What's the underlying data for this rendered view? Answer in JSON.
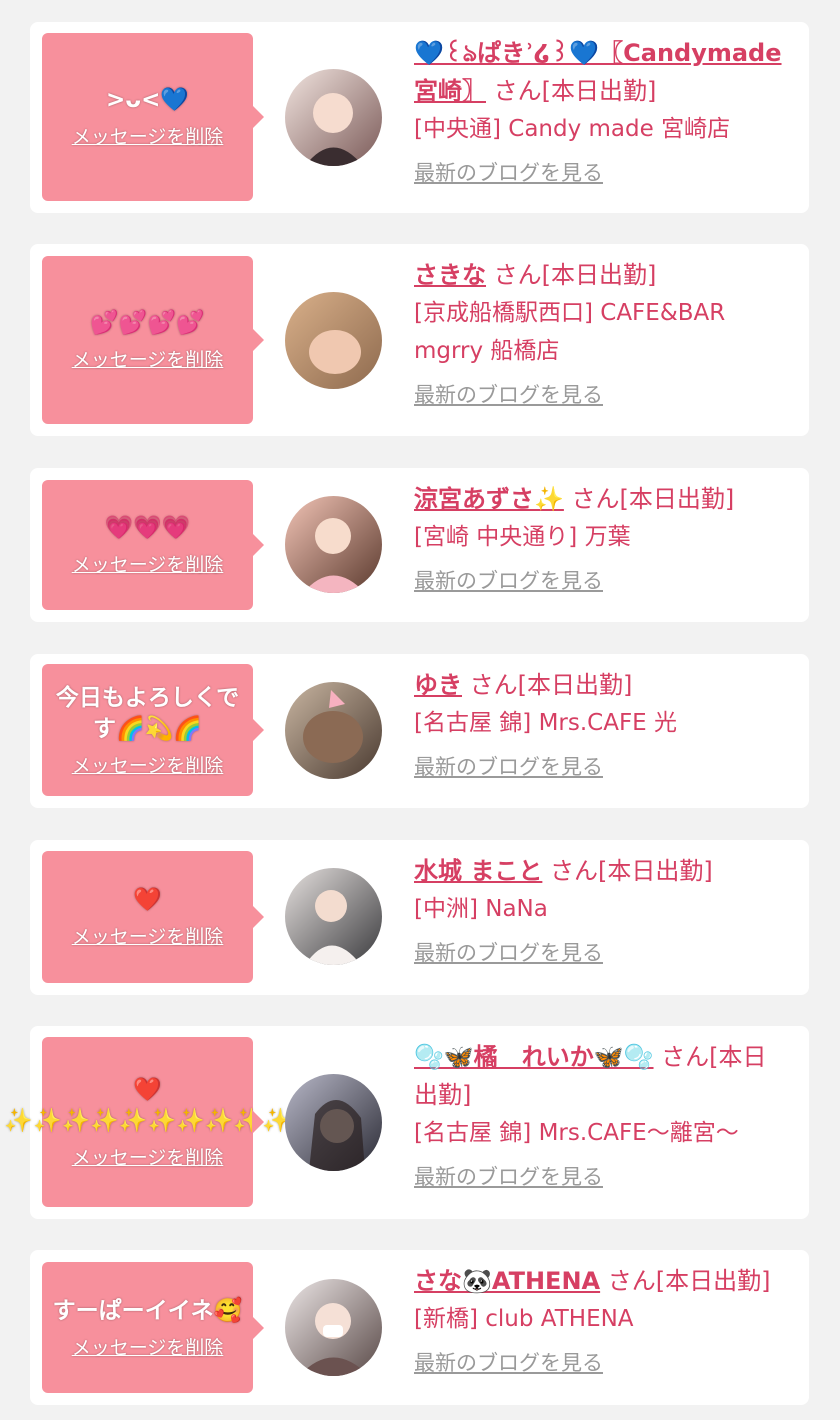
{
  "cards": [
    {
      "message": ">ᴗ<💙",
      "delete_label": "メッセージを削除",
      "name": "💙꒰ঌぱきʾ໒꒱💙〖Candymade宮崎〗",
      "suffix": " さん[本日出勤]",
      "shop": "[中央通] Candy made 宮崎店",
      "blog_label": "最新のブログを見る",
      "avatar_colors": [
        "#f1e4df",
        "#7b5a58"
      ]
    },
    {
      "message": "💕💕💕💕",
      "delete_label": "メッセージを削除",
      "name": "さきな",
      "suffix": " さん[本日出勤]",
      "shop": "[京成船橋駅西口] CAFE&BAR mgrry 船橋店",
      "blog_label": "最新のブログを見る",
      "avatar_colors": [
        "#d9b08a",
        "#8e6a4e"
      ]
    },
    {
      "message": "💗💗💗",
      "delete_label": "メッセージを削除",
      "name": "涼宮あずさ✨",
      "suffix": " さん[本日出勤]",
      "shop": "[宮崎 中央通り] 万葉",
      "blog_label": "最新のブログを見る",
      "avatar_colors": [
        "#f2c4b6",
        "#5b3a2e"
      ]
    },
    {
      "message": "今日もよろしくです🌈💫🌈",
      "delete_label": "メッセージを削除",
      "name": "ゆき",
      "suffix": " さん[本日出勤]",
      "shop": "[名古屋 錦] Mrs.CAFE 光",
      "blog_label": "最新のブログを見る",
      "avatar_colors": [
        "#c9b6a2",
        "#4a3a30"
      ]
    },
    {
      "message": "❤️",
      "delete_label": "メッセージを削除",
      "name": "水城 まこと",
      "suffix": " さん[本日出勤]",
      "shop": "[中洲] NaNa",
      "blog_label": "最新のブログを見る",
      "avatar_colors": [
        "#e6e1df",
        "#3b3b3e"
      ]
    },
    {
      "message": "❤️ ✨✨✨✨✨✨✨✨✨✨",
      "delete_label": "メッセージを削除",
      "name": "🫧🦋橘　れいか🦋🫧",
      "suffix": " さん[本日出勤]",
      "shop": "[名古屋 錦] Mrs.CAFE～離宮～",
      "blog_label": "最新のブログを見る",
      "avatar_colors": [
        "#b8b8c8",
        "#2b2b35"
      ]
    },
    {
      "message": "すーぱーイイネ🥰",
      "delete_label": "メッセージを削除",
      "name": "さな🐼ATHENA",
      "suffix": " さん[本日出勤]",
      "shop": "[新橋] club ATHENA",
      "blog_label": "最新のブログを見る",
      "avatar_colors": [
        "#ece6e6",
        "#5a4a48"
      ]
    }
  ]
}
